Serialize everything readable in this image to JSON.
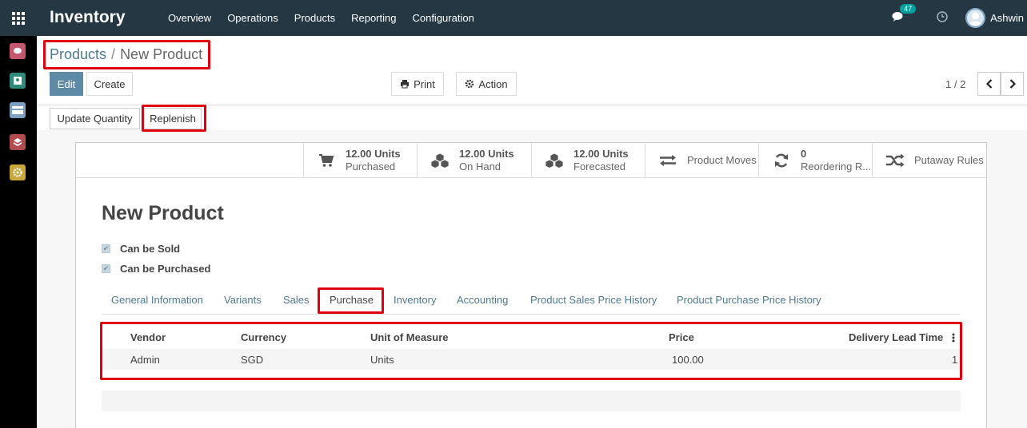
{
  "app": {
    "title": "Inventory",
    "menu": [
      "Overview",
      "Operations",
      "Products",
      "Reporting",
      "Configuration"
    ],
    "notification_count": "47",
    "user_name": "Ashwin"
  },
  "sidebar_apps": [
    "discuss-app-icon",
    "contacts-app-icon",
    "invoicing-app-icon",
    "inventory-app-icon",
    "settings-app-icon"
  ],
  "breadcrumb": {
    "parent": "Products",
    "separator": "/",
    "current": "New Product"
  },
  "toolbar": {
    "edit": "Edit",
    "create": "Create",
    "print": "Print",
    "action": "Action",
    "pager": "1 / 2"
  },
  "status_buttons": {
    "update_quantity": "Update Quantity",
    "replenish": "Replenish"
  },
  "smart_buttons": [
    {
      "value": "12.00 Units",
      "label": "Purchased",
      "icon": "cart-icon"
    },
    {
      "value": "12.00 Units",
      "label": "On Hand",
      "icon": "cubes-icon"
    },
    {
      "value": "12.00 Units",
      "label": "Forecasted",
      "icon": "cubes-icon"
    },
    {
      "value": "",
      "label": "Product Moves",
      "icon": "exchange-icon"
    },
    {
      "value": "0",
      "label": "Reordering R...",
      "icon": "refresh-icon"
    },
    {
      "value": "",
      "label": "Putaway Rules",
      "icon": "random-icon"
    }
  ],
  "product": {
    "name": "New Product",
    "can_be_sold": "Can be Sold",
    "can_be_purchased": "Can be Purchased"
  },
  "tabs": [
    "General Information",
    "Variants",
    "Sales",
    "Purchase",
    "Inventory",
    "Accounting",
    "Product Sales Price History",
    "Product Purchase Price History"
  ],
  "active_tab": "Purchase",
  "vendor_table": {
    "columns": [
      "Vendor",
      "Currency",
      "Unit of Measure",
      "Price",
      "Delivery Lead Time"
    ],
    "rows": [
      [
        "Admin",
        "SGD",
        "Units",
        "100.00",
        "1"
      ]
    ]
  },
  "colors": {
    "navbar": "#243742",
    "accent": "#5f8aa5",
    "highlight": "#e0000f",
    "badge": "#00a09d"
  }
}
